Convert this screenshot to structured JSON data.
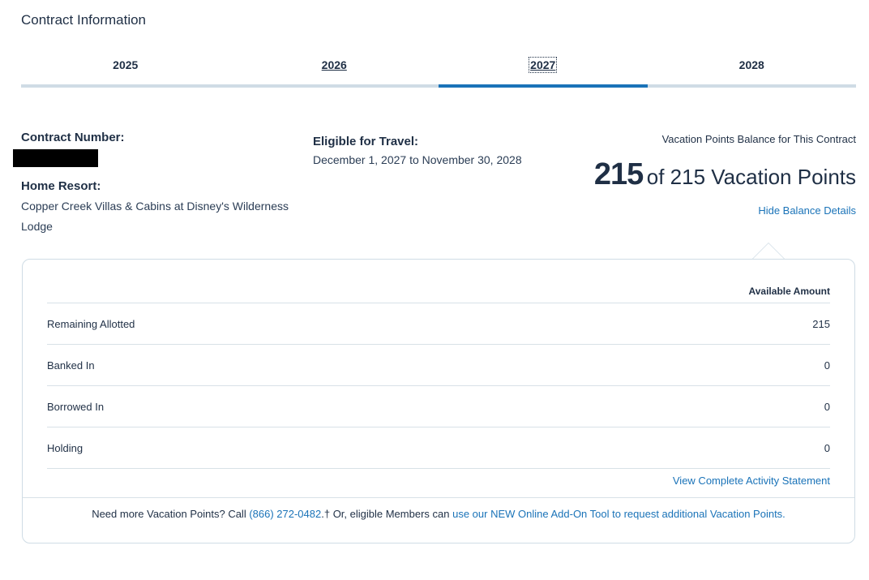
{
  "page_title": "Contract Information",
  "tabs": [
    {
      "label": "2025"
    },
    {
      "label": "2026"
    },
    {
      "label": "2027"
    },
    {
      "label": "2028"
    }
  ],
  "active_tab": "2027",
  "contract": {
    "number_label": "Contract Number:",
    "home_resort_label": "Home Resort:",
    "home_resort_value": "Copper Creek Villas & Cabins at Disney's Wilderness Lodge",
    "eligible_label": "Eligible for Travel:",
    "eligible_value": "December 1, 2027 to November 30, 2028"
  },
  "balance": {
    "caption": "Vacation Points Balance for This Contract",
    "current": "215",
    "total_text": "of 215 Vacation Points",
    "hide_link": "Hide Balance Details"
  },
  "details": {
    "column_header": "Available Amount",
    "rows": [
      {
        "label": "Remaining Allotted",
        "value": "215"
      },
      {
        "label": "Banked In",
        "value": "0"
      },
      {
        "label": "Borrowed In",
        "value": "0"
      },
      {
        "label": "Holding",
        "value": "0"
      }
    ],
    "activity_link": "View Complete Activity Statement"
  },
  "footer": {
    "text_1": "Need more Vacation Points? Call ",
    "phone": "(866) 272-0482",
    "text_2": ".† Or, eligible Members can ",
    "tool_link": "use our NEW Online Add-On Tool to request additional Vacation Points."
  },
  "colors": {
    "accent": "#1a73b8",
    "tab_rail": "#cfdce5",
    "text": "#1f2f45"
  }
}
